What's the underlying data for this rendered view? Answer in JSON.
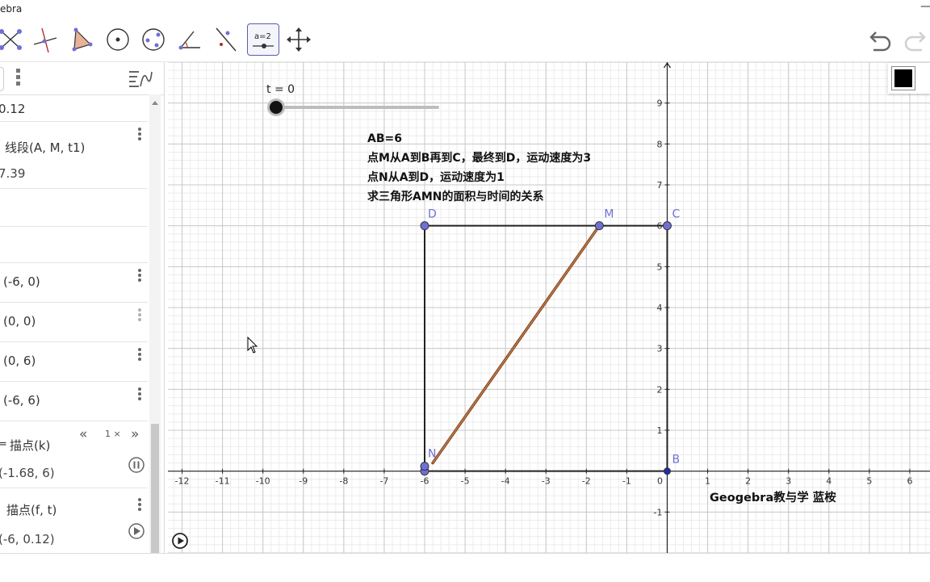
{
  "window": {
    "title": "ebra",
    "minimize": "—",
    "maximize": "□"
  },
  "toolbar": {
    "tools": [
      "polygon-tool",
      "line-tool",
      "triangle-tool",
      "circle-tool",
      "circle-3pt-tool",
      "angle-tool",
      "reflect-tool",
      "slider-tool",
      "move-graphics-tool"
    ],
    "slider_icon_label": "a=2",
    "active_tool": "slider-tool"
  },
  "algebra": {
    "rows": [
      {
        "value": "0.12"
      },
      {
        "value": "线段(A, M, t1)",
        "sub": "7.39"
      },
      {
        "value": ""
      },
      {
        "value": "(-6, 0)"
      },
      {
        "value": "(0, 0)"
      },
      {
        "value": "(0, 6)"
      },
      {
        "value": "(-6, 6)"
      },
      {
        "prefix": "=",
        "value": "描点(k)",
        "sub": "(-1.68, 6)",
        "anim_speed": "1 ×"
      },
      {
        "value": "描点(f, t)",
        "sub": "(-6, 0.12)"
      }
    ]
  },
  "slider": {
    "label": "t = 0",
    "value": 0
  },
  "description": {
    "line1": "AB=6",
    "line2": "点M从A到B再到C，最终到D，运动速度为3",
    "line3": "点N从A到D，运动速度为1",
    "line4": "求三角形AMN的面积与时间的关系"
  },
  "watermark": "Geogebra教与学  蓝桉",
  "points": {
    "A": {
      "label": "",
      "x": -6,
      "y": 0
    },
    "B": {
      "label": "B",
      "x": 0,
      "y": 0
    },
    "C": {
      "label": "C",
      "x": 0,
      "y": 6
    },
    "D": {
      "label": "D",
      "x": -6,
      "y": 6
    },
    "M": {
      "label": "M",
      "x": -1.68,
      "y": 6
    },
    "N": {
      "label": "N",
      "x": -6,
      "y": 0.12
    }
  },
  "axes": {
    "x_ticks": [
      "-12",
      "-11",
      "-10",
      "-9",
      "-8",
      "-7",
      "-6",
      "-5",
      "-4",
      "-3",
      "-2",
      "-1",
      "0",
      "1",
      "2",
      "3",
      "4",
      "5",
      "6"
    ],
    "y_ticks": [
      "-1",
      "1",
      "2",
      "3",
      "4",
      "5",
      "6",
      "7",
      "8",
      "9"
    ],
    "xlim": [
      -12.35,
      6.5
    ],
    "ylim": [
      -2.0,
      10.0
    ]
  },
  "colors": {
    "point": "#6f70d6",
    "segment": "#8a4b24",
    "square": "#222222",
    "grid_major": "#c9c9c9",
    "grid_minor": "#ececec"
  }
}
